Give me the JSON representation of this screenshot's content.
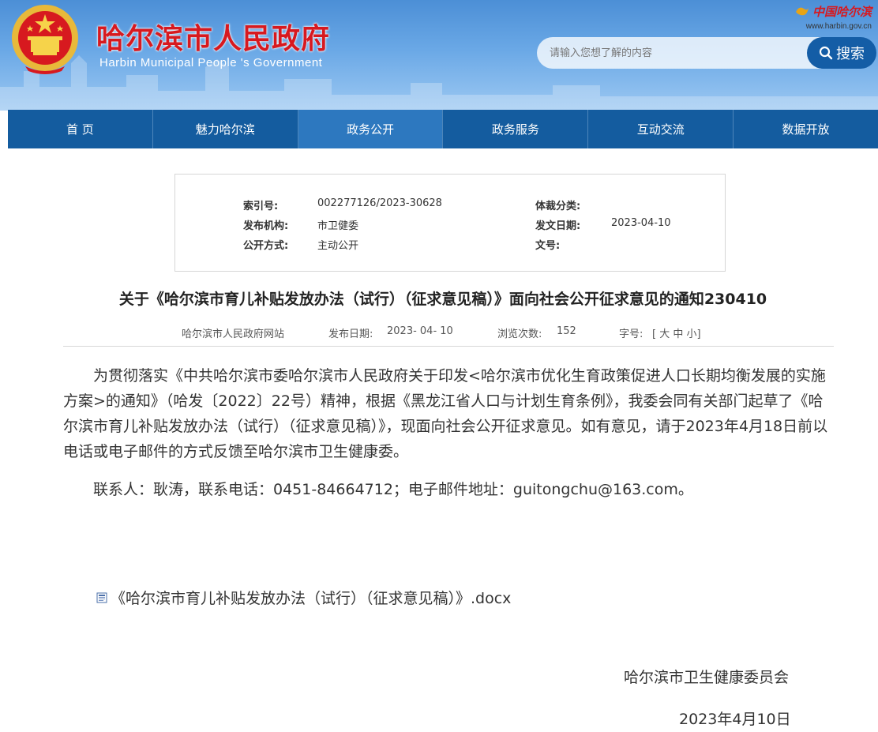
{
  "header": {
    "title_cn": "哈尔滨市人民政府",
    "title_en": "Harbin Municipal People 's Government",
    "brand_cn": "中国哈尔滨",
    "brand_url": "www.harbin.gov.cn",
    "search_placeholder": "请输入您想了解的内容",
    "search_button": "搜索"
  },
  "nav": {
    "items": [
      {
        "label": "首 页"
      },
      {
        "label": "魅力哈尔滨"
      },
      {
        "label": "政务公开"
      },
      {
        "label": "政务服务"
      },
      {
        "label": "互动交流"
      },
      {
        "label": "数据开放"
      }
    ],
    "active_index": 2
  },
  "meta": {
    "index_key": "索引号:",
    "index_val": "002277126/2023-30628",
    "genre_key": "体裁分类:",
    "genre_val": "",
    "org_key": "发布机构:",
    "org_val": "市卫健委",
    "date_key": "发文日期:",
    "date_val": "2023-04-10",
    "mode_key": "公开方式:",
    "mode_val": "主动公开",
    "docno_key": "文号:",
    "docno_val": ""
  },
  "article": {
    "title": "关于《哈尔滨市育儿补贴发放办法（试行）（征求意见稿）》面向社会公开征求意见的通知230410",
    "source": "哈尔滨市人民政府网站",
    "pub_date_label": "发布日期:",
    "pub_date": "2023- 04- 10",
    "views_label": "浏览次数:",
    "views": "152",
    "font_label": "字号:",
    "font_options": "[ 大 中 小]",
    "paragraph1": "为贯彻落实《中共哈尔滨市委哈尔滨市人民政府关于印发<哈尔滨市优化生育政策促进人口长期均衡发展的实施方案>的通知》（哈发〔2022〕22号）精神，根据《黑龙江省人口与计划生育条例》，我委会同有关部门起草了《哈尔滨市育儿补贴发放办法（试行）（征求意见稿）》，现面向社会公开征求意见。如有意见，请于2023年4月18日前以电话或电子邮件的方式反馈至哈尔滨市卫生健康委。",
    "paragraph2": "联系人：耿涛，联系电话：0451-84664712；电子邮件地址：guitongchu@163.com。",
    "attachment": "《哈尔滨市育儿补贴发放办法（试行）（征求意见稿）》.docx",
    "signature_org": "哈尔滨市卫生健康委员会",
    "signature_date": "2023年4月10日"
  },
  "colors": {
    "nav_bg": "#145c9f",
    "nav_active": "#2d78bf",
    "title_red": "#d7191f",
    "search_btn": "#145da6"
  }
}
